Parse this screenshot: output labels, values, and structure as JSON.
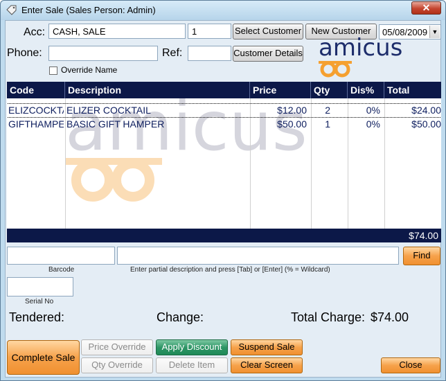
{
  "window": {
    "title": "Enter Sale (Sales Person: Admin)",
    "close_glyph": "✕"
  },
  "account": {
    "acc_label": "Acc:",
    "acc_value": "CASH, SALE",
    "acc_number": "1",
    "select_customer": "Select Customer",
    "new_customer": "New Customer",
    "date": "05/08/2009",
    "phone_label": "Phone:",
    "phone_value": "",
    "ref_label": "Ref:",
    "ref_value": "",
    "customer_details": "Customer Details",
    "override_name": "Override Name"
  },
  "logo": {
    "text": "amicus"
  },
  "grid": {
    "columns": [
      "Code",
      "Description",
      "Price",
      "Qty",
      "Dis%",
      "Total"
    ],
    "rows": [
      {
        "code": "ELIZCOCKTA",
        "description": "ELIZER COCKTAIL",
        "price": "$12.00",
        "qty": "2",
        "discount": "0%",
        "total": "$24.00"
      },
      {
        "code": "GIFTHAMPEI",
        "description": "BASIC GIFT HAMPER",
        "price": "$50.00",
        "qty": "1",
        "discount": "0%",
        "total": "$50.00"
      }
    ],
    "grand_total": "$74.00"
  },
  "search": {
    "barcode_value": "",
    "barcode_caption": "Barcode",
    "description_value": "",
    "description_caption": "Enter partial description and press [Tab] or [Enter] (% = Wildcard)",
    "find_button": "Find",
    "serial_value": "",
    "serial_caption": "Serial No"
  },
  "summary": {
    "tendered_label": "Tendered:",
    "change_label": "Change:",
    "total_charge_label": "Total Charge:",
    "total_charge_value": "$74.00"
  },
  "actions": {
    "complete_sale": "Complete Sale",
    "price_override": "Price Override",
    "qty_override": "Qty Override",
    "apply_discount": "Apply Discount",
    "delete_item": "Delete Item",
    "suspend_sale": "Suspend Sale",
    "clear_screen": "Clear Screen",
    "close": "Close"
  },
  "colors": {
    "orange": "#f09030",
    "navy": "#0c1848",
    "green": "#1e8a58",
    "logo_orange": "#f5a030",
    "logo_navy": "#1d2d6b"
  }
}
